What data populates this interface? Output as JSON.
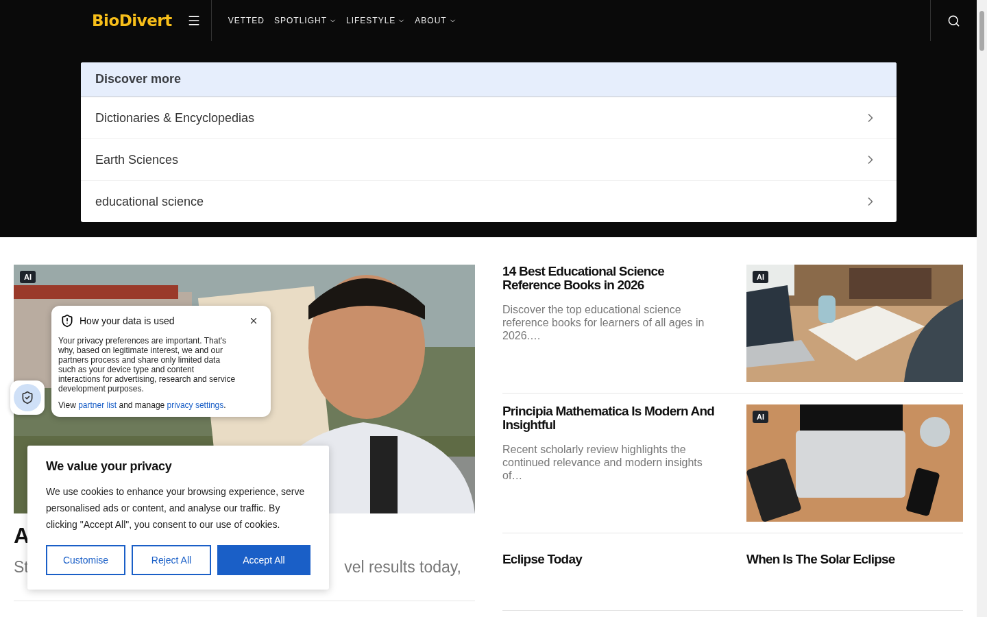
{
  "header": {
    "logo": "BioDivert",
    "nav": [
      {
        "label": "VETTED",
        "dropdown": false
      },
      {
        "label": "SPOTLIGHT",
        "dropdown": true
      },
      {
        "label": "LIFESTYLE",
        "dropdown": true
      },
      {
        "label": "ABOUT",
        "dropdown": true
      }
    ]
  },
  "discover": {
    "title": "Discover more",
    "items": [
      "Dictionaries & Encyclopedias",
      "Earth Sciences",
      "educational science"
    ]
  },
  "lead_article": {
    "badge": "AI",
    "title": "A",
    "excerpt_start": "St",
    "excerpt_end": "vel results today,"
  },
  "articles": [
    {
      "title": "14 Best Educational Science Reference Books in 2026",
      "excerpt": "Discover the top educational science reference books for learners of all ages in 2026.…",
      "badge": "AI",
      "kind": "books"
    },
    {
      "title": "Principia Mathematica Is Modern And Insightful",
      "excerpt": "Recent scholarly review highlights the continued relevance and modern insights of…",
      "badge": "AI",
      "kind": "desk"
    }
  ],
  "more_links": [
    "Eclipse Today",
    "When Is The Solar Eclipse"
  ],
  "data_popup": {
    "title": "How your data is used",
    "body": "Your privacy preferences are important. That's why, based on legitimate interest, we and our partners process and share only limited data such as your device type and content interactions for advertising, research and service development purposes.",
    "footer_start": "View ",
    "link_1": "partner list",
    "footer_middle": " and manage ",
    "link_2": "privacy settings",
    "footer_end": "."
  },
  "cookie_banner": {
    "title": "We value your privacy",
    "body": "We use cookies to enhance your browsing experience, serve personalised ads or content, and analyse our traffic. By clicking \"Accept All\", you consent to our use of cookies.",
    "buttons": [
      {
        "label": "Customise",
        "primary": false
      },
      {
        "label": "Reject All",
        "primary": false
      },
      {
        "label": "Accept All",
        "primary": true
      }
    ]
  }
}
